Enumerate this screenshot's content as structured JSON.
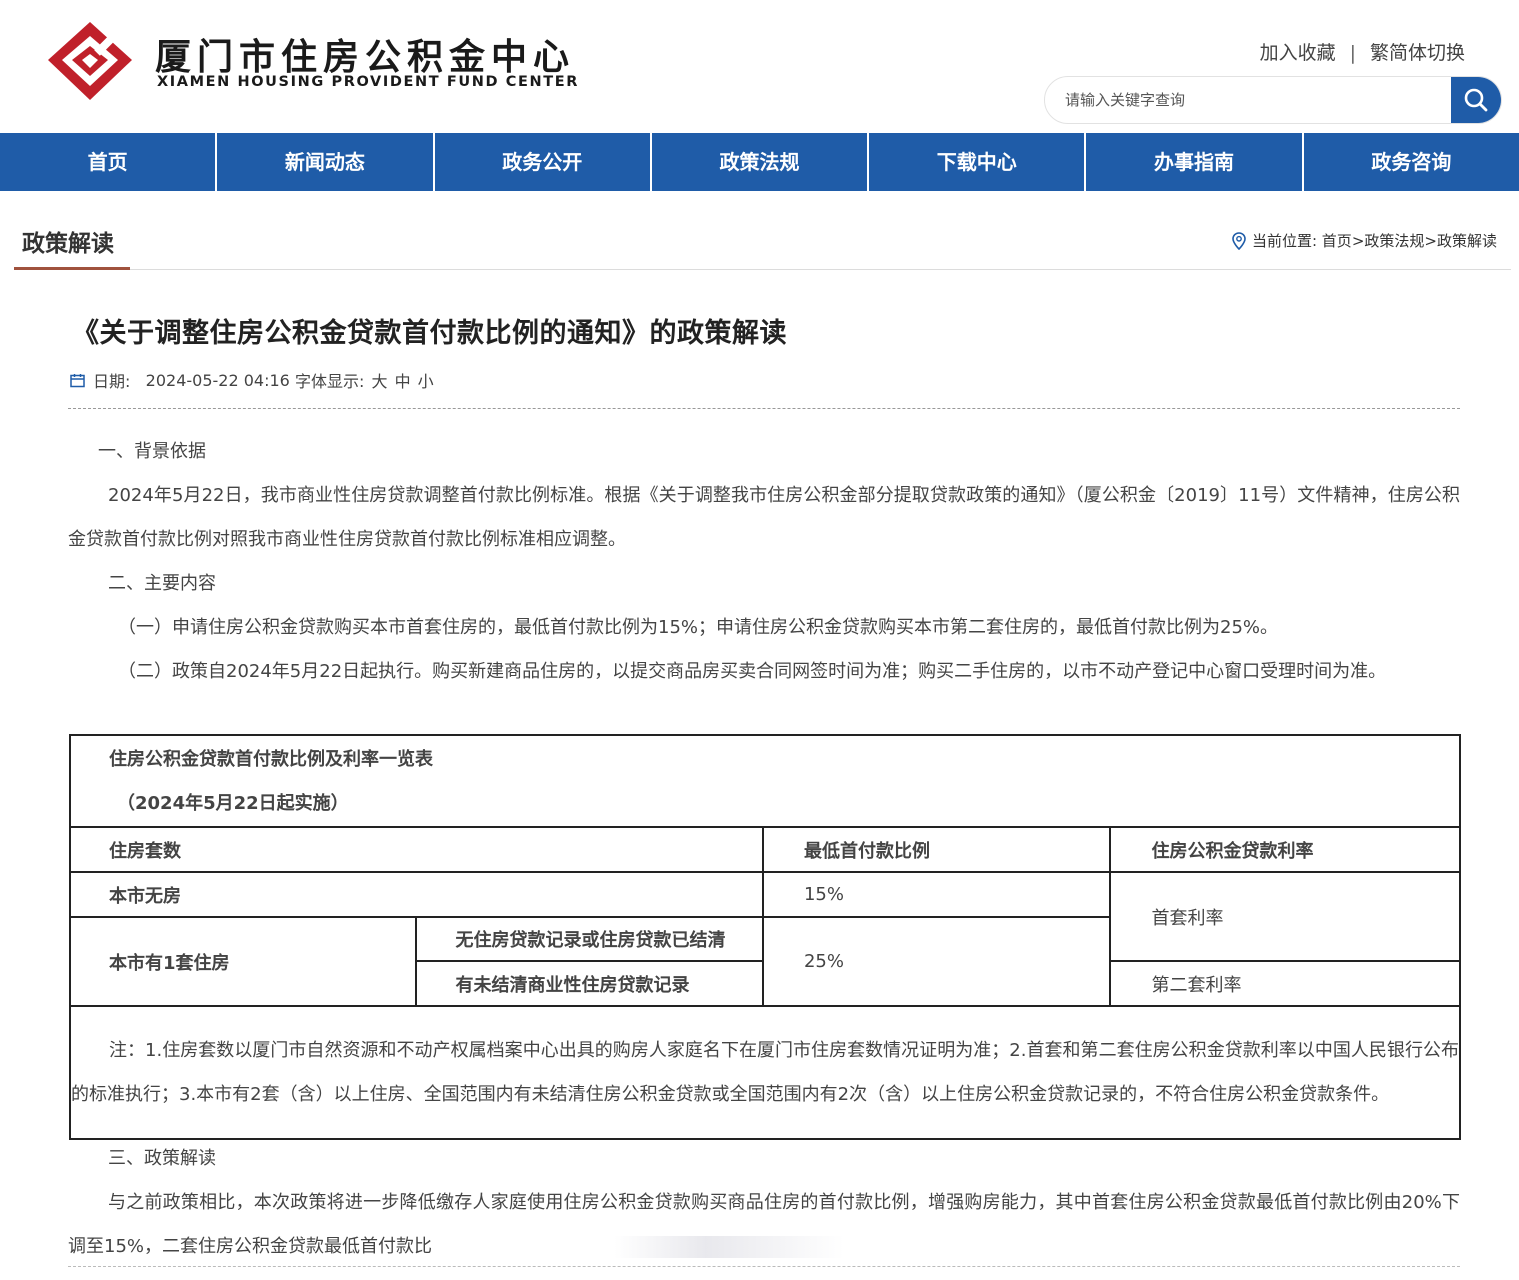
{
  "header": {
    "site_title_cn": "厦门市住房公积金中心",
    "site_title_en": "XIAMEN HOUSING PROVIDENT FUND CENTER",
    "add_favorite": "加入收藏",
    "separator": "|",
    "lang_switch": "繁简体切换",
    "search_placeholder": "请输入关键字查询",
    "brand_color": "#c0202a",
    "nav_color": "#1f5ca8"
  },
  "nav": {
    "items": [
      "首页",
      "新闻动态",
      "政务公开",
      "政策法规",
      "下载中心",
      "办事指南",
      "政务咨询"
    ]
  },
  "section": {
    "title": "政策解读",
    "breadcrumb_prefix": "当前位置:",
    "crumbs": [
      "首页",
      "政策法规",
      "政策解读"
    ],
    "crumb_sep": ">"
  },
  "article": {
    "title": "《关于调整住房公积金贷款首付款比例的通知》的政策解读",
    "date_label": "日期:",
    "date": "2024-05-22 04:16",
    "font_label": "字体显示:",
    "font_sizes": [
      "大",
      "中",
      "小"
    ],
    "h1": "一、背景依据",
    "p1": "2024年5月22日，我市商业性住房贷款调整首付款比例标准。根据《关于调整我市住房公积金部分提取贷款政策的通知》（厦公积金〔2019〕11号）文件精神，住房公积金贷款首付款比例对照我市商业性住房贷款首付款比例标准相应调整。",
    "h2": "二、主要内容",
    "p2": "（一）申请住房公积金贷款购买本市首套住房的，最低首付款比例为15%；申请住房公积金贷款购买本市第二套住房的，最低首付款比例为25%。",
    "p3": "（二）政策自2024年5月22日起执行。购买新建商品住房的，以提交商品房买卖合同网签时间为准；购买二手住房的，以市不动产登记中心窗口受理时间为准。",
    "h3": "三、政策解读",
    "p4": "与之前政策相比，本次政策将进一步降低缴存人家庭使用住房公积金贷款购买商品住房的首付款比例，增强购房能力，其中首套住房公积金贷款最低首付款比例由20%下调至15%，二套住房公积金贷款最低首付款比"
  },
  "table": {
    "caption": "住房公积金贷款首付款比例及利率一览表",
    "caption_sub": "（2024年5月22日起实施）",
    "headers": [
      "住房套数",
      "最低首付款比例",
      "住房公积金贷款利率"
    ],
    "row1_label": "本市无房",
    "row1_ratio": "15%",
    "rate_first": "首套利率",
    "row2_label": "本市有1套住房",
    "row2a": "无住房贷款记录或住房贷款已结清",
    "row2b": "有未结清商业性住房贷款记录",
    "row2_ratio": "25%",
    "rate_second": "第二套利率",
    "note": "注：1.住房套数以厦门市自然资源和不动产权属档案中心出具的购房人家庭名下在厦门市住房套数情况证明为准；2.首套和第二套住房公积金贷款利率以中国人民银行公布的标准执行；3.本市有2套（含）以上住房、全国范围内有未结清住房公积金贷款或全国范围内有2次（含）以上住房公积金贷款记录的，不符合住房公积金贷款条件。"
  }
}
